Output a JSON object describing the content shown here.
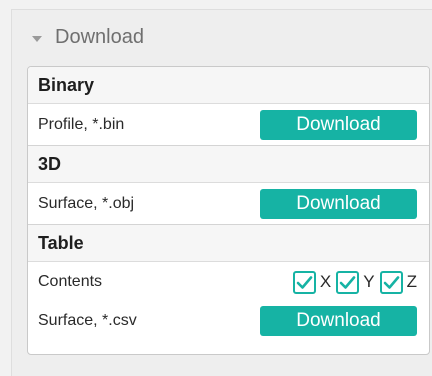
{
  "panel": {
    "title": "Download",
    "sections": [
      {
        "title": "Binary",
        "rows": [
          {
            "label": "Profile, *.bin",
            "button": "Download"
          }
        ]
      },
      {
        "title": "3D",
        "rows": [
          {
            "label": "Surface, *.obj",
            "button": "Download"
          }
        ]
      },
      {
        "title": "Table",
        "contents_label": "Contents",
        "checkboxes": [
          {
            "label": "X",
            "checked": true
          },
          {
            "label": "Y",
            "checked": true
          },
          {
            "label": "Z",
            "checked": true
          }
        ],
        "rows": [
          {
            "label": "Surface, *.csv",
            "button": "Download"
          }
        ]
      }
    ]
  },
  "colors": {
    "accent": "#16b3a4"
  }
}
